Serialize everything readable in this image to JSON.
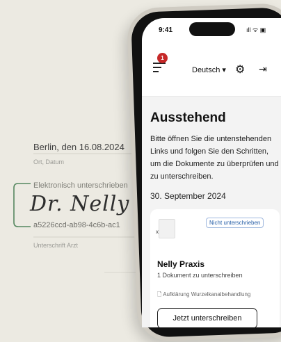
{
  "background_document": {
    "place_date_prefix": "Berlin, den ",
    "place_date_value": "16.08.2024",
    "place_date_label": "Ort, Datum",
    "esig_label": "Elektronisch unterschrieben",
    "signature_text": "Dr. Nelly",
    "hash": "a5226ccd-ab98-4c6b-ac1",
    "signature_label": "Unterschrift Arzt"
  },
  "statusbar": {
    "time": "9:41",
    "icons": "ıll ᯤ ▣"
  },
  "header": {
    "menu_badge": "1",
    "language": "Deutsch ▾",
    "settings_icon": "gear-icon",
    "logout_icon": "logout-icon"
  },
  "main": {
    "title": "Ausstehend",
    "intro": "Bitte öffnen Sie die untenstehenden Links und folgen Sie den Schritten, um die Dokumente zu überprüfen und zu unterschreiben.",
    "date_heading": "30. September 2024",
    "card": {
      "status": "Nicht unterschrieben",
      "name": "Nelly Praxis",
      "count": "1 Dokument zu unterschreiben",
      "file_name": "Aufklärung Wurzelkanalbehandlung",
      "sign_button": "Jetzt unterschreiben"
    }
  },
  "colors": {
    "badge": "#c62828",
    "status_text": "#2860a8",
    "background": "#eceae2"
  }
}
